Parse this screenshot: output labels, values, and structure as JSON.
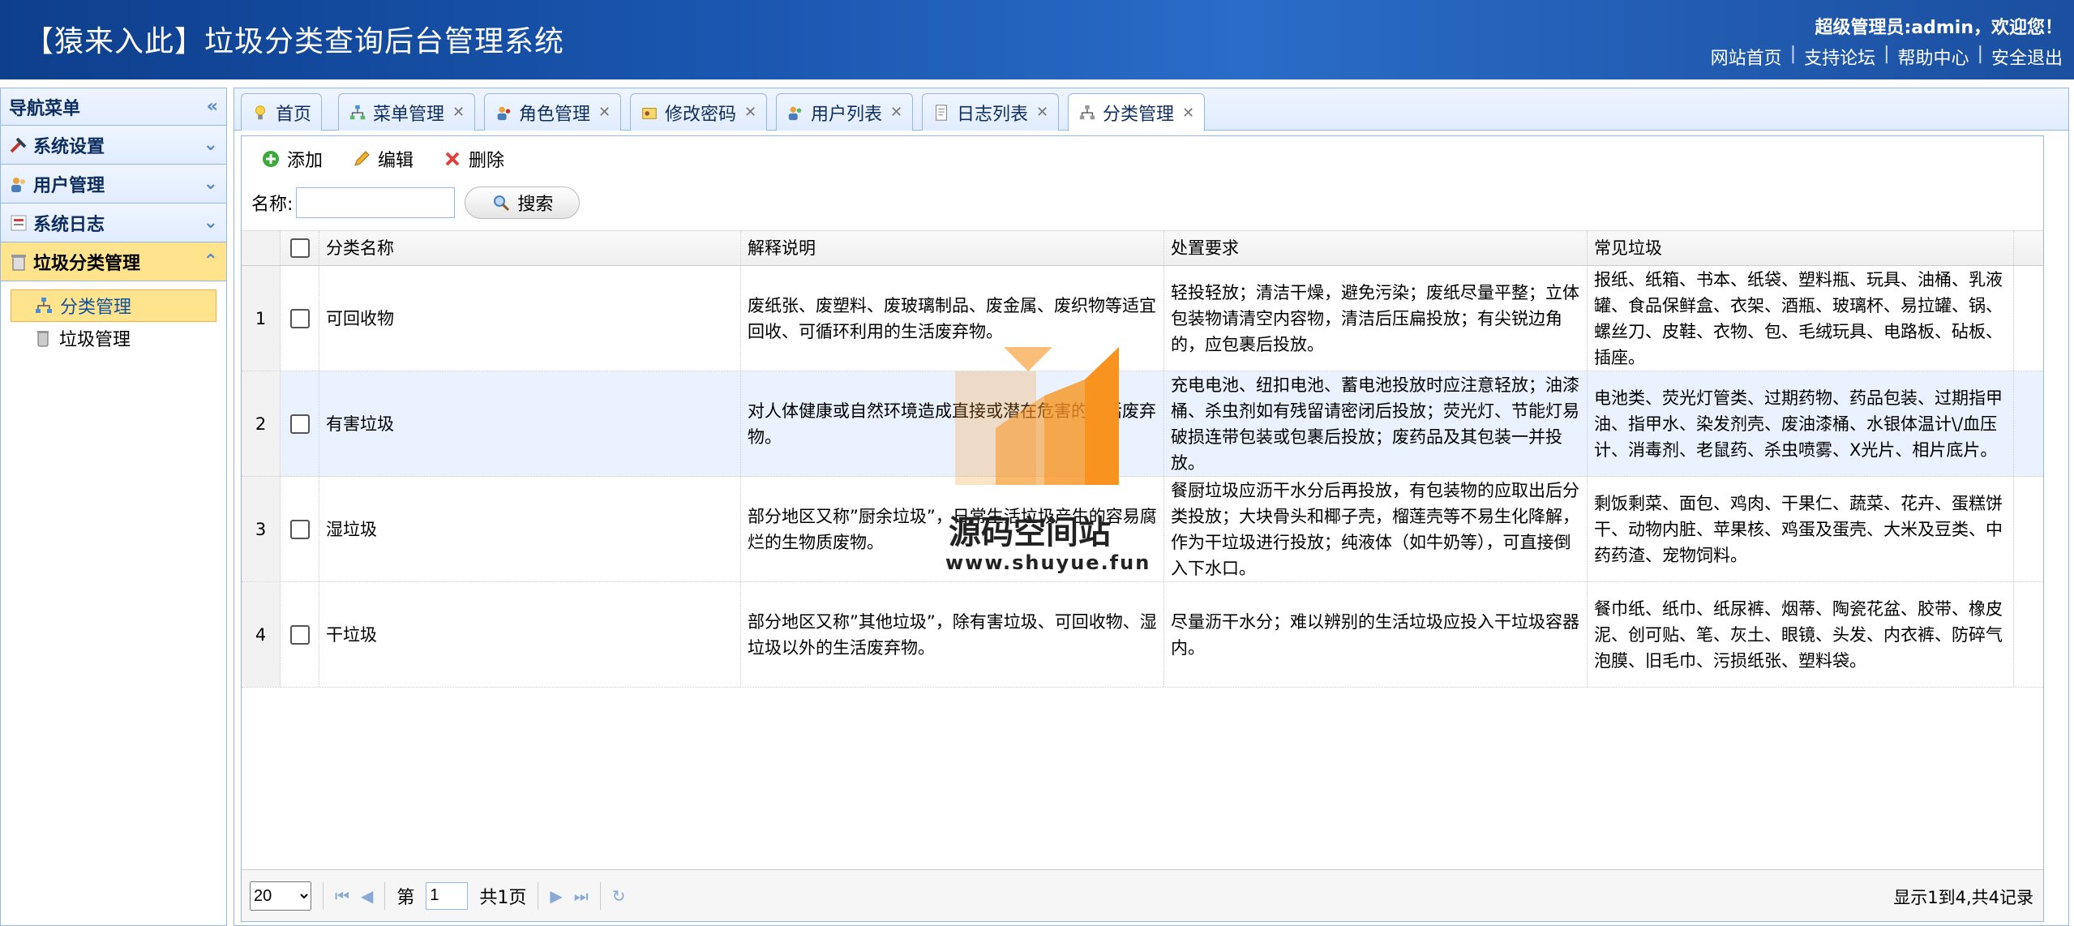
{
  "header": {
    "title": "【猿来入此】垃圾分类查询后台管理系统",
    "welcome": "超级管理员:admin，欢迎您！",
    "links": [
      "网站首页",
      "支持论坛",
      "帮助中心",
      "安全退出"
    ]
  },
  "sidebar": {
    "title": "导航菜单",
    "groups": [
      {
        "label": "系统设置",
        "icon": "tools-icon"
      },
      {
        "label": "用户管理",
        "icon": "users-icon"
      },
      {
        "label": "系统日志",
        "icon": "log-icon"
      },
      {
        "label": "垃圾分类管理",
        "icon": "trash-icon",
        "expanded": true
      }
    ],
    "items": [
      {
        "label": "分类管理",
        "active": true
      },
      {
        "label": "垃圾管理",
        "active": false
      }
    ]
  },
  "tabs": [
    {
      "label": "首页",
      "icon": "lightbulb-icon",
      "closable": false
    },
    {
      "label": "菜单管理",
      "icon": "sitemap-icon",
      "closable": true
    },
    {
      "label": "角色管理",
      "icon": "role-icon",
      "closable": true
    },
    {
      "label": "修改密码",
      "icon": "password-icon",
      "closable": true
    },
    {
      "label": "用户列表",
      "icon": "users-icon",
      "closable": true
    },
    {
      "label": "日志列表",
      "icon": "document-icon",
      "closable": true
    },
    {
      "label": "分类管理",
      "icon": "sitemap-icon",
      "closable": true,
      "active": true
    }
  ],
  "toolbar": {
    "add": "添加",
    "edit": "编辑",
    "delete": "删除",
    "name_label": "名称:",
    "search": "搜索",
    "search_value": ""
  },
  "table": {
    "columns": [
      "分类名称",
      "解释说明",
      "处置要求",
      "常见垃圾"
    ],
    "rows": [
      {
        "num": "1",
        "name": "可回收物",
        "desc": "废纸张、废塑料、废玻璃制品、废金属、废织物等适宜回收、可循环利用的生活废弃物。",
        "req": "轻投轻放；清洁干燥，避免污染；废纸尽量平整；立体包装物请清空内容物，清洁后压扁投放；有尖锐边角的，应包裹后投放。",
        "common": "报纸、纸箱、书本、纸袋、塑料瓶、玩具、油桶、乳液罐、食品保鲜盒、衣架、酒瓶、玻璃杯、易拉罐、锅、螺丝刀、皮鞋、衣物、包、毛绒玩具、电路板、砧板、插座。"
      },
      {
        "num": "2",
        "name": "有害垃圾",
        "desc": "对人体健康或自然环境造成直接或潜在危害的生活废弃物。",
        "req": "充电电池、纽扣电池、蓄电池投放时应注意轻放；油漆桶、杀虫剂如有残留请密闭后投放；荧光灯、节能灯易破损连带包装或包裹后投放；废药品及其包装一并投放。",
        "common": "电池类、荧光灯管类、过期药物、药品包装、过期指甲油、指甲水、染发剂壳、废油漆桶、水银体温计\\/血压计、消毒剂、老鼠药、杀虫喷雾、X光片、相片底片。"
      },
      {
        "num": "3",
        "name": "湿垃圾",
        "desc": "部分地区又称”厨余垃圾”，日常生活垃圾产生的容易腐烂的生物质废物。",
        "req": "餐厨垃圾应沥干水分后再投放，有包装物的应取出后分类投放；大块骨头和椰子壳，榴莲壳等不易生化降解，作为干垃圾进行投放；纯液体（如牛奶等），可直接倒入下水口。",
        "common": "剩饭剩菜、面包、鸡肉、干果仁、蔬菜、花卉、蛋糕饼干、动物内脏、苹果核、鸡蛋及蛋壳、大米及豆类、中药药渣、宠物饲料。"
      },
      {
        "num": "4",
        "name": "干垃圾",
        "desc": "部分地区又称”其他垃圾”，除有害垃圾、可回收物、湿垃圾以外的生活废弃物。",
        "req": "尽量沥干水分；难以辨别的生活垃圾应投入干垃圾容器内。",
        "common": "餐巾纸、纸巾、纸尿裤、烟蒂、陶瓷花盆、胶带、橡皮泥、创可贴、笔、灰土、眼镜、头发、内衣裤、防碎气泡膜、旧毛巾、污损纸张、塑料袋。"
      }
    ]
  },
  "pager": {
    "page_size": "20",
    "page_prefix": "第",
    "page_value": "1",
    "page_suffix": "共1页",
    "info": "显示1到4,共4记录"
  },
  "watermark": {
    "text": "源码空间站",
    "url": "www.shuyue.fun"
  },
  "colors": {
    "header_bg": "#1a56b0",
    "panel_border": "#95b8e7",
    "active_highlight": "#ffe48d",
    "watermark_orange": "#f7931e"
  }
}
